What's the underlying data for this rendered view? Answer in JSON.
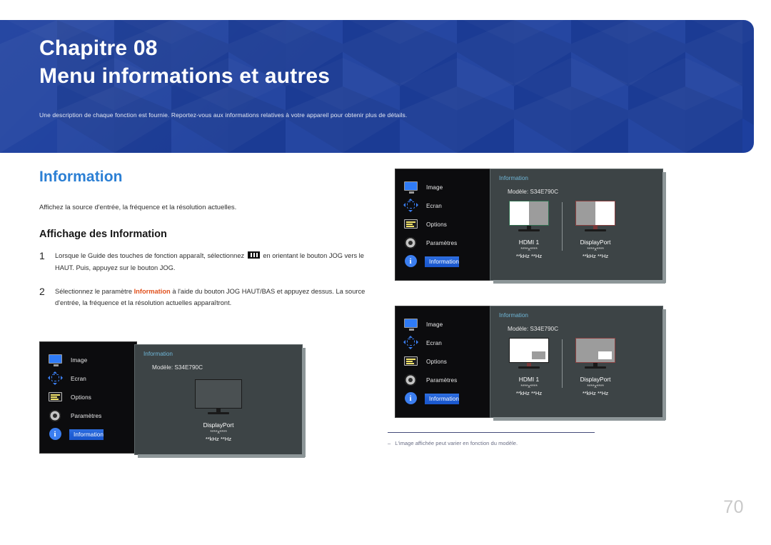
{
  "banner": {
    "chapter": "Chapitre 08",
    "title": "Menu informations et autres",
    "subtitle": "Une description de chaque fonction est fournie. Reportez-vous aux informations relatives à votre appareil pour obtenir plus de détails.",
    "color": "#1d3f9e"
  },
  "section": {
    "title": "Information",
    "title_color": "#2b7fd4",
    "description": "Affichez la source d'entrée, la fréquence et la résolution actuelles.",
    "subheading": "Affichage des Information"
  },
  "steps": [
    {
      "num": "1",
      "text_before": "Lorsque le Guide des touches de fonction apparaît, sélectionnez ",
      "icon": "jog-menu-icon",
      "text_after": " en orientant le bouton JOG vers le HAUT. Puis, appuyez sur le bouton JOG."
    },
    {
      "num": "2",
      "text_before": "Sélectionnez le paramètre ",
      "keyword": "Information",
      "keyword_color": "#e0501c",
      "text_after": " à l'aide du bouton JOG HAUT/BAS et appuyez dessus. La source d'entrée, la fréquence et la résolution actuelles apparaîtront."
    }
  ],
  "osd_menu_items": [
    {
      "label": "Image",
      "icon": "monitor-icon",
      "selected": false
    },
    {
      "label": "Ecran",
      "icon": "screen-arrows-icon",
      "selected": false
    },
    {
      "label": "Options",
      "icon": "options-lines-icon",
      "selected": false
    },
    {
      "label": "Paramètres",
      "icon": "gear-icon",
      "selected": false
    },
    {
      "label": "Information",
      "icon": "info-circle-icon",
      "selected": true
    }
  ],
  "osd_panel": {
    "title": "Information",
    "model": "Modèle: S34E790C"
  },
  "osd_single": {
    "mode": "single",
    "displays": [
      {
        "source": "DisplayPort",
        "resolution": "****x****",
        "frequency": "**kHz **Hz",
        "fill": "full-gray"
      }
    ]
  },
  "osd_pbp": {
    "mode": "pbp",
    "displays": [
      {
        "source": "HDMI 1",
        "resolution": "****x****",
        "frequency": "**kHz **Hz",
        "fill": "left-white-right-gray",
        "border": "#2f6f4f"
      },
      {
        "source": "DisplayPort",
        "resolution": "****x****",
        "frequency": "**kHz **Hz",
        "fill": "left-gray-right-white",
        "border": "#8a4040"
      }
    ]
  },
  "osd_pip": {
    "mode": "pip",
    "displays": [
      {
        "source": "HDMI 1",
        "resolution": "****x****",
        "frequency": "**kHz **Hz",
        "fill": "white-with-gray-inset",
        "border": "#1a1a1a"
      },
      {
        "source": "DisplayPort",
        "resolution": "****x****",
        "frequency": "**kHz **Hz",
        "fill": "gray-with-white-inset",
        "border": "#8a4040"
      }
    ]
  },
  "footnote": {
    "dash": "‒",
    "text": "L'image affichée peut varier en fonction du modèle."
  },
  "page_number": "70"
}
